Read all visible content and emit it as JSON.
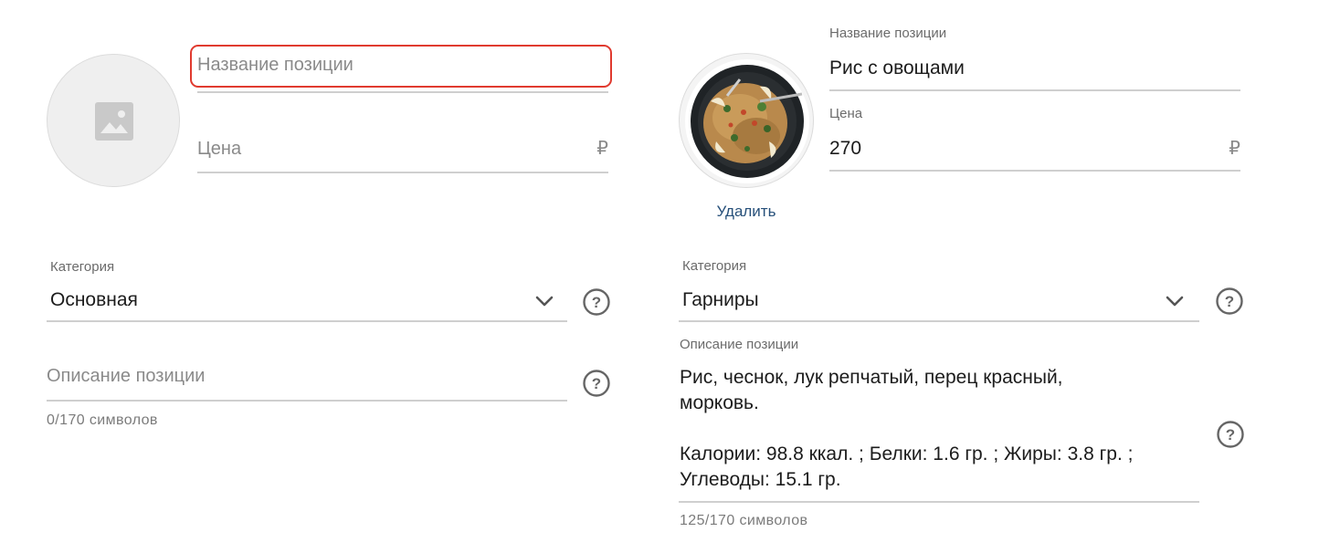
{
  "new_item": {
    "name_placeholder": "Название позиции",
    "price_placeholder": "Цена",
    "currency": "₽",
    "category_label": "Категория",
    "category_value": "Основная",
    "description_placeholder": "Описание позиции",
    "char_counter": "0/170 символов"
  },
  "existing_item": {
    "name_label": "Название позиции",
    "name_value": "Рис с овощами",
    "price_label": "Цена",
    "price_value": "270",
    "currency": "₽",
    "delete_label": "Удалить",
    "category_label": "Категория",
    "category_value": "Гарниры",
    "description_label": "Описание позиции",
    "description_lines": [
      "Рис, чеснок, лук репчатый, перец красный,",
      "морковь.",
      "",
      "Калории: 98.8 ккал. ; Белки: 1.6 гр. ; Жиры: 3.8 гр. ;",
      "Углеводы: 15.1 гр."
    ],
    "char_counter": "125/170 символов"
  },
  "icons": {
    "placeholder": "image-placeholder-icon",
    "chevron": "chevron-down-icon",
    "help": "help-circle-icon"
  },
  "colors": {
    "error_border": "#e03a2f",
    "link": "#27507a",
    "underline": "#cfcfcf"
  }
}
